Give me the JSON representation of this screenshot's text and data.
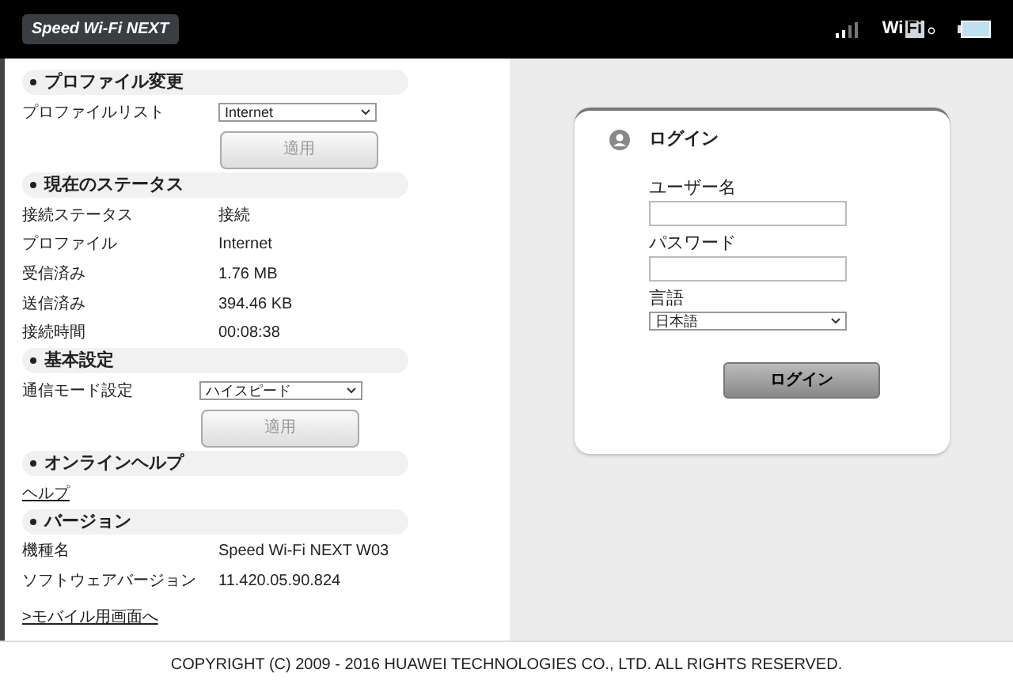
{
  "header": {
    "logo": "Speed Wi-Fi NEXT",
    "wifi_logo": {
      "part_1": "Wi",
      "part_2": "Fi"
    }
  },
  "sections": [
    {
      "title": "プロファイル変更",
      "rows": [
        {
          "kind": "select",
          "label": "プロファイルリスト",
          "value": "Internet"
        },
        {
          "kind": "button",
          "label": "適用",
          "disabled": true
        }
      ]
    },
    {
      "title": "現在のステータス",
      "rows": [
        {
          "kind": "pair",
          "label": "接続ステータス",
          "value": "接続"
        },
        {
          "kind": "pair",
          "label": "プロファイル",
          "value": "Internet"
        },
        {
          "kind": "pair",
          "label": "受信済み",
          "value": "1.76 MB"
        },
        {
          "kind": "pair",
          "label": "送信済み",
          "value": "394.46 KB"
        },
        {
          "kind": "pair",
          "label": "接続時間",
          "value": "00:08:38"
        }
      ]
    },
    {
      "title": "基本設定",
      "rows": [
        {
          "kind": "select",
          "label": "通信モード設定",
          "value": "ハイスピード"
        },
        {
          "kind": "button",
          "label": "適用",
          "disabled": true
        }
      ]
    },
    {
      "title": "オンラインヘルプ",
      "rows": [
        {
          "kind": "link",
          "label": "ヘルプ"
        }
      ]
    },
    {
      "title": "バージョン",
      "rows": [
        {
          "kind": "pair",
          "label": "機種名",
          "value": "Speed Wi-Fi NEXT W03"
        },
        {
          "kind": "pair",
          "label": "ソフトウェアバージョン",
          "value": "11.420.05.90.824"
        }
      ]
    }
  ],
  "mobile_link": ">モバイル用画面へ",
  "login": {
    "title": "ログイン",
    "username_label": "ユーザー名",
    "password_label": "パスワード",
    "language_label": "言語",
    "language": "日本語",
    "button": "ログイン"
  },
  "footer": "COPYRIGHT (C) 2009 - 2016 HUAWEI TECHNOLOGIES CO., LTD. ALL RIGHTS RESERVED."
}
